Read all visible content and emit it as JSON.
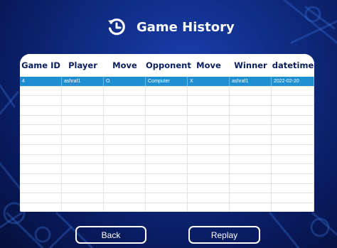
{
  "header": {
    "title": "Game History",
    "icon": "history-icon"
  },
  "table": {
    "columns": [
      "Game ID",
      "Player",
      "Move",
      "Opponent",
      "Move",
      "Winner",
      "datetime"
    ],
    "rows": [
      [
        "4",
        "ashraf1",
        "O",
        "Computer",
        "X",
        "ashraf1",
        "2022-02-20"
      ]
    ],
    "selected_row": 0,
    "selection_color": "#1e8fd0"
  },
  "buttons": {
    "back_label": "Back",
    "replay_label": "Replay"
  },
  "colors": {
    "background": "#0f2b82",
    "header_text": "#0b1e5c"
  }
}
